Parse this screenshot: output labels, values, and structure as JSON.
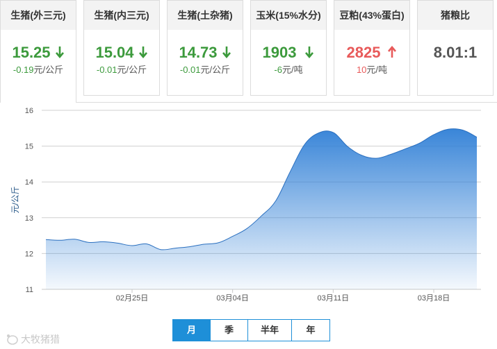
{
  "cards": [
    {
      "title": "生猪(外三元)",
      "price": "15.25",
      "direction": "down",
      "change": "-0.19",
      "unit": "元/公斤"
    },
    {
      "title": "生猪(内三元)",
      "price": "15.04",
      "direction": "down",
      "change": "-0.01",
      "unit": "元/公斤"
    },
    {
      "title": "生猪(土杂猪)",
      "price": "14.73",
      "direction": "down",
      "change": "-0.01",
      "unit": "元/公斤"
    },
    {
      "title": "玉米(15%水分)",
      "price": "1903",
      "direction": "down",
      "change": "-6",
      "unit": "元/吨"
    },
    {
      "title": "豆粕(43%蛋白)",
      "price": "2825",
      "direction": "up",
      "change": "10",
      "unit": "元/吨"
    },
    {
      "title": "猪粮比",
      "price": "8.01:1",
      "direction": "none",
      "change": "",
      "unit": ""
    }
  ],
  "colors": {
    "down": "#3c9a3c",
    "up": "#e85a5a",
    "accent": "#1e8fd8",
    "series": "#2f7fd6"
  },
  "chart_data": {
    "type": "area",
    "ylabel": "元/公斤",
    "ylim": [
      11,
      16
    ],
    "yticks": [
      "11",
      "12",
      "13",
      "14",
      "15",
      "16"
    ],
    "xticks": [
      {
        "day": 6,
        "label": "02月25日"
      },
      {
        "day": 13,
        "label": "03月04日"
      },
      {
        "day": 20,
        "label": "03月11日"
      },
      {
        "day": 27,
        "label": "03月18日"
      }
    ],
    "x": [
      0,
      1,
      2,
      3,
      4,
      5,
      6,
      7,
      8,
      9,
      10,
      11,
      12,
      13,
      14,
      15,
      16,
      17,
      18,
      19,
      20,
      21,
      22,
      23,
      24,
      25,
      26,
      27,
      28,
      29,
      30
    ],
    "values": [
      12.39,
      12.37,
      12.4,
      12.31,
      12.33,
      12.29,
      12.22,
      12.27,
      12.11,
      12.15,
      12.19,
      12.26,
      12.3,
      12.48,
      12.7,
      13.05,
      13.47,
      14.28,
      15.04,
      15.37,
      15.38,
      14.99,
      14.74,
      14.66,
      14.77,
      14.92,
      15.08,
      15.32,
      15.47,
      15.45,
      15.25
    ],
    "grid": true,
    "legend": "none"
  },
  "periods": {
    "items": [
      "月",
      "季",
      "半年",
      "年"
    ],
    "selected": 0
  },
  "watermark": "大牧猪猎"
}
